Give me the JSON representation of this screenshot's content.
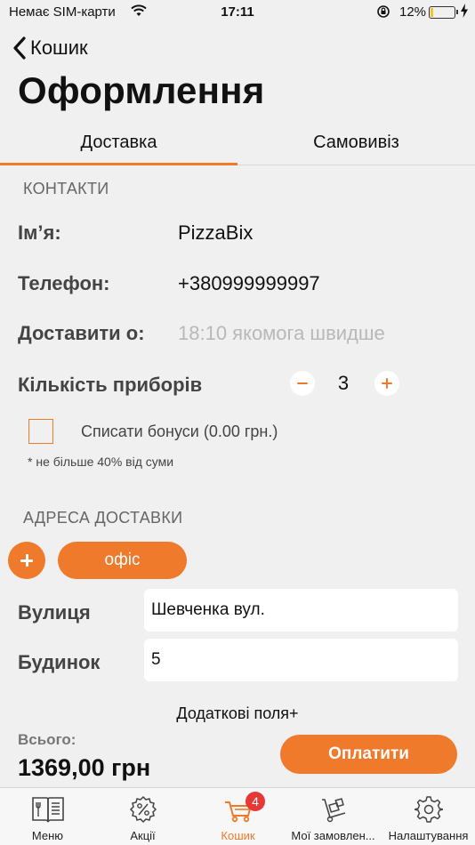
{
  "status_bar": {
    "carrier": "Немає SIM-карти",
    "time": "17:11",
    "battery_percent": "12%",
    "battery_level": 0.12
  },
  "nav": {
    "back_label": "Кошик",
    "title": "Оформлення"
  },
  "tabs": [
    {
      "label": "Доставка",
      "active": true
    },
    {
      "label": "Самовивіз",
      "active": false
    }
  ],
  "contacts": {
    "header": "КОНТАКТИ",
    "name_label": "Ім’я:",
    "name_value": "PizzaBix",
    "phone_label": "Телефон:",
    "phone_value": "+380999999997",
    "deliver_label": "Доставити о:",
    "deliver_placeholder": "18:10 якомога швидше",
    "cutlery_label": "Кількість приборів",
    "cutlery_count": "3",
    "bonus_label": "Списати бонуси  (0.00 грн.)",
    "bonus_note": "* не більше 40% від суми",
    "bonus_checked": false
  },
  "address": {
    "header": "АДРЕСА ДОСТАВКИ",
    "chip_label": "офіс",
    "street_label": "Вулиця",
    "street_value": "Шевченка вул.",
    "house_label": "Будинок",
    "house_value": "5",
    "extra_fields_label": "Додаткові поля+"
  },
  "summary": {
    "total_label": "Всього:",
    "total_value": "1369,00 грн",
    "pay_label": "Оплатити"
  },
  "tabbar": [
    {
      "label": "Меню",
      "icon": "menu-book-icon"
    },
    {
      "label": "Акції",
      "icon": "percent-badge-icon"
    },
    {
      "label": "Кошик",
      "icon": "cart-icon",
      "badge": "4",
      "active": true
    },
    {
      "label": "Мої замовлен...",
      "icon": "hand-truck-icon"
    },
    {
      "label": "Налаштування",
      "icon": "gear-icon"
    }
  ],
  "colors": {
    "accent": "#ef7a2c",
    "badge": "#e53935"
  }
}
